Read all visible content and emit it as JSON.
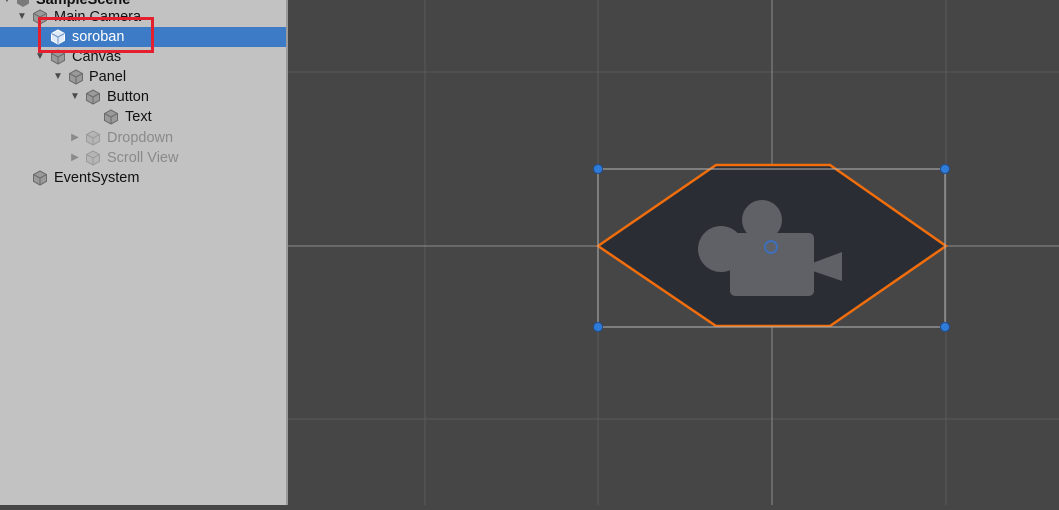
{
  "hierarchy": {
    "scene_name": "SampleScene",
    "items": [
      {
        "label": "Main Camera",
        "depth": 1,
        "expanded": true,
        "selected": false,
        "inactive": false
      },
      {
        "label": "soroban",
        "depth": 2,
        "selected": true,
        "inactive": false
      },
      {
        "label": "Canvas",
        "depth": 1,
        "expanded": true,
        "selected": false,
        "inactive": false
      },
      {
        "label": "Panel",
        "depth": 2,
        "expanded": true,
        "selected": false,
        "inactive": false
      },
      {
        "label": "Button",
        "depth": 3,
        "expanded": true,
        "selected": false,
        "inactive": false
      },
      {
        "label": "Text",
        "depth": 4,
        "selected": false,
        "inactive": false
      },
      {
        "label": "Dropdown",
        "depth": 3,
        "expanded": false,
        "selected": false,
        "inactive": true
      },
      {
        "label": "Scroll View",
        "depth": 3,
        "expanded": false,
        "selected": false,
        "inactive": true
      },
      {
        "label": "EventSystem",
        "depth": 0,
        "selected": false,
        "inactive": false
      }
    ]
  },
  "scene_view": {
    "background": "#464646",
    "grid_color": "#5a5a5a",
    "selection_outline": "#f26d0c",
    "handle_color": "#2f7bd8",
    "gizmo_icon": "camera-icon"
  },
  "colors": {
    "hierarchy_bg": "#c2c2c2",
    "selection_bg": "#3e7bc6",
    "annotation_box": "#e5202e"
  }
}
